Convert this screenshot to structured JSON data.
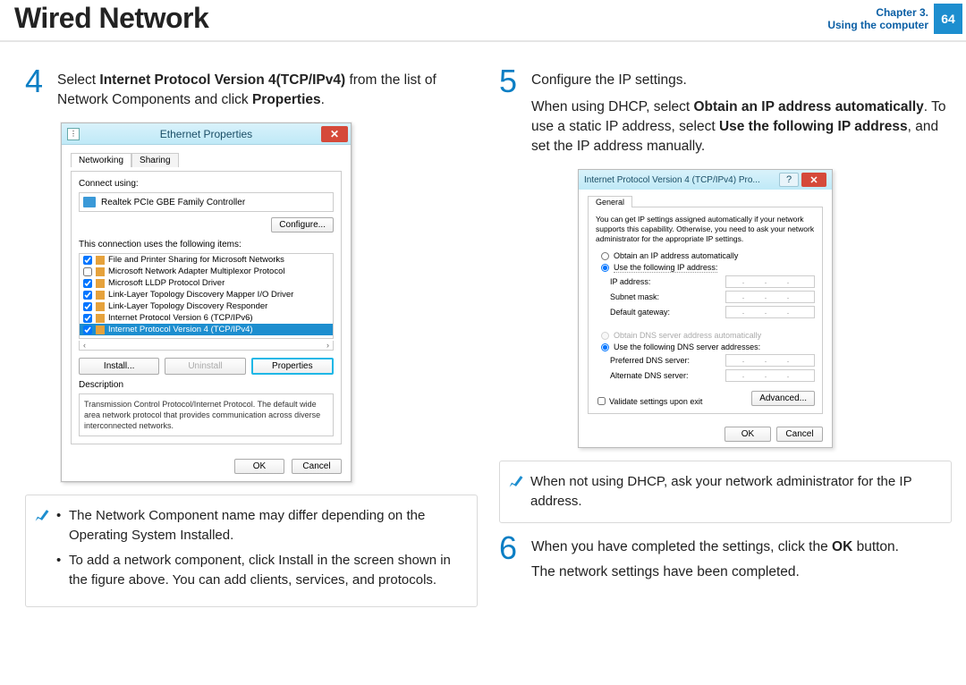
{
  "header": {
    "title": "Wired Network",
    "chapter_line1": "Chapter 3.",
    "chapter_line2": "Using the computer",
    "page_number": "64"
  },
  "step4": {
    "num": "4",
    "text_before": "Select ",
    "bold1": "Internet Protocol Version 4(TCP/IPv4)",
    "text_mid": " from the list of Network Components and click ",
    "bold2": "Properties",
    "text_after": "."
  },
  "ethernet_window": {
    "title": "Ethernet Properties",
    "tabs": {
      "networking": "Networking",
      "sharing": "Sharing"
    },
    "connect_using_label": "Connect using:",
    "adapter_name": "Realtek PCIe GBE Family Controller",
    "configure_btn": "Configure...",
    "uses_items_label": "This connection uses the following items:",
    "items": [
      "File and Printer Sharing for Microsoft Networks",
      "Microsoft Network Adapter Multiplexor Protocol",
      "Microsoft LLDP Protocol Driver",
      "Link-Layer Topology Discovery Mapper I/O Driver",
      "Link-Layer Topology Discovery Responder",
      "Internet Protocol Version 6 (TCP/IPv6)",
      "Internet Protocol Version 4 (TCP/IPv4)"
    ],
    "install_btn": "Install...",
    "uninstall_btn": "Uninstall",
    "properties_btn": "Properties",
    "desc_label": "Description",
    "desc_text": "Transmission Control Protocol/Internet Protocol. The default wide area network protocol that provides communication across diverse interconnected networks.",
    "ok_btn": "OK",
    "cancel_btn": "Cancel"
  },
  "note_left": {
    "b1": "The Network Component name may differ depending on the Operating System Installed.",
    "b2": "To add a network component, click Install in the screen shown in the figure above. You can add clients, services, and protocols."
  },
  "step5": {
    "num": "5",
    "l1": "Configure the IP settings.",
    "l2a": "When using DHCP, select ",
    "l2b": "Obtain an IP address automatically",
    "l2c": ". To use a static IP address, select ",
    "l2d": "Use the following IP address",
    "l2e": ", and set the IP address manually."
  },
  "ipv4_window": {
    "title": "Internet Protocol Version 4 (TCP/IPv4) Pro...",
    "general_tab": "General",
    "intro": "You can get IP settings assigned automatically if your network supports this capability. Otherwise, you need to ask your network administrator for the appropriate IP settings.",
    "r_obtain_ip": "Obtain an IP address automatically",
    "r_use_ip": "Use the following IP address:",
    "f_ip": "IP address:",
    "f_subnet": "Subnet mask:",
    "f_gateway": "Default gateway:",
    "r_obtain_dns": "Obtain DNS server address automatically",
    "r_use_dns": "Use the following DNS server addresses:",
    "f_pdns": "Preferred DNS server:",
    "f_adns": "Alternate DNS server:",
    "validate": "Validate settings upon exit",
    "advanced": "Advanced...",
    "ok": "OK",
    "cancel": "Cancel",
    "dots": ".   .   ."
  },
  "note_right": {
    "text": "When not using DHCP, ask your network administrator for the IP address."
  },
  "step6": {
    "num": "6",
    "l1a": "When you have completed the settings, click the ",
    "l1b": "OK",
    "l1c": " button.",
    "l2": "The network settings have been completed."
  }
}
